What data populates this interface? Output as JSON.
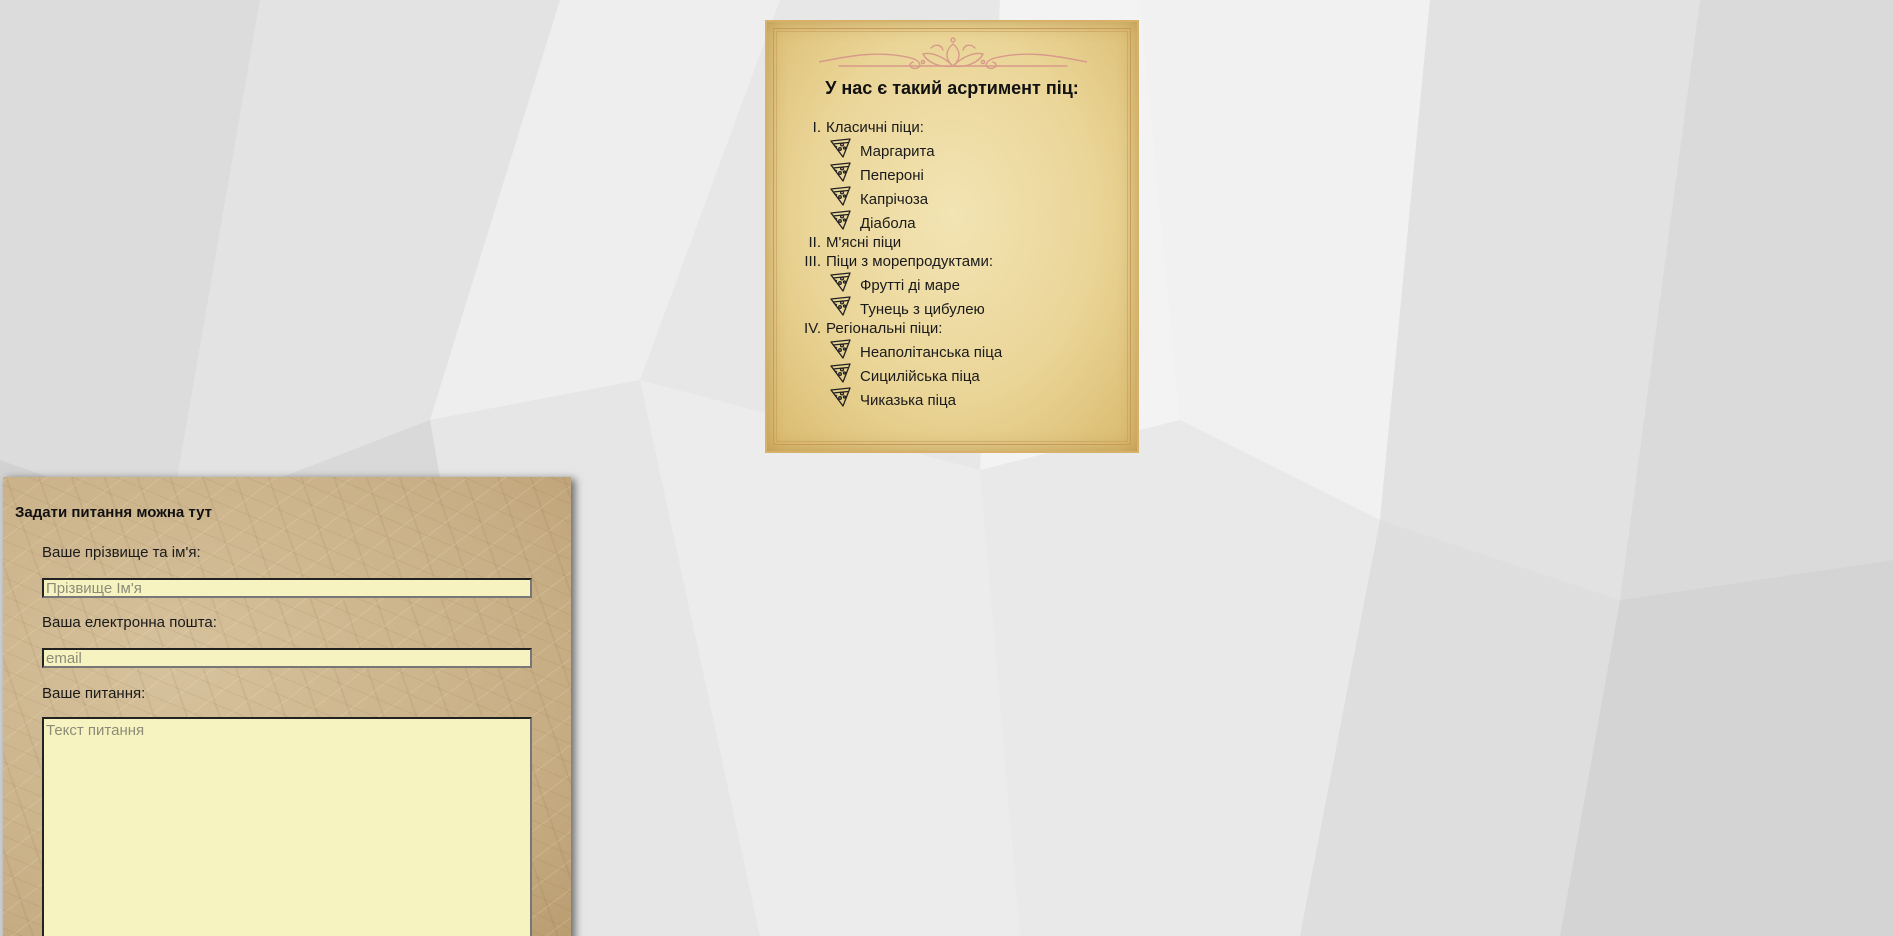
{
  "colors": {
    "page_background": "#e6e6e6",
    "parchment": "#ead597",
    "form_panel": "#cdb58d",
    "input_background": "#f6f3c0"
  },
  "menu": {
    "title": "У нас є такий асртимент піц:",
    "categories": [
      {
        "number": "I.",
        "label": "Класичні піци:",
        "items": [
          "Маргарита",
          "Пепероні",
          "Капрічоза",
          "Діабола"
        ]
      },
      {
        "number": "II.",
        "label": "М'ясні піци",
        "items": []
      },
      {
        "number": "III.",
        "label": "Піци з морепродуктами:",
        "items": [
          "Фрутті ді маре",
          "Тунець з цибулею"
        ]
      },
      {
        "number": "IV.",
        "label": "Регіональні піци:",
        "items": [
          "Неаполітанська піца",
          "Сицилійська піца",
          "Чиказька піца"
        ]
      }
    ],
    "item_icon": "pizza-slice-icon"
  },
  "form": {
    "title": "Задати питання можна тут",
    "name_label": "Ваше прізвище та ім'я:",
    "name_placeholder": "Прізвище Ім'я",
    "name_value": "",
    "email_label": "Ваша електронна пошта:",
    "email_placeholder": "email",
    "email_value": "",
    "question_label": "Ваше питання:",
    "question_placeholder": "Текст питання",
    "question_value": ""
  }
}
